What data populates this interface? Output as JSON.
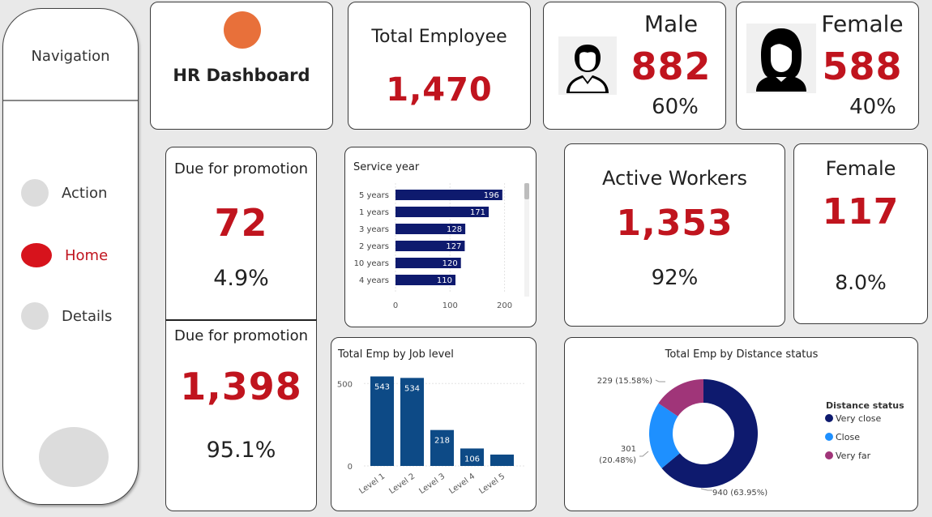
{
  "nav": {
    "title": "Navigation",
    "items": [
      {
        "label": "Action",
        "color": "#dcdcdc",
        "text_color": "#333333"
      },
      {
        "label": "Home",
        "color": "#d7131c",
        "text_color": "#c0141e"
      },
      {
        "label": "Details",
        "color": "#dcdcdc",
        "text_color": "#333333"
      }
    ]
  },
  "header": {
    "title": "HR Dashboard",
    "logo_color": "#e8703a"
  },
  "kpi": {
    "total_employee": {
      "label": "Total Employee",
      "value": "1,470"
    },
    "male": {
      "label": "Male",
      "value": "882",
      "pct": "60%"
    },
    "female": {
      "label": "Female",
      "value": "588",
      "pct": "40%"
    },
    "promo1": {
      "label": "Due for promotion",
      "value": "72",
      "pct": "4.9%"
    },
    "promo2": {
      "label": "Due for promotion",
      "value": "1,398",
      "pct": "95.1%"
    },
    "active": {
      "label": "Active Workers",
      "value": "1,353",
      "pct": "92%"
    },
    "female2": {
      "label": "Female",
      "value": "117",
      "pct": "8.0%"
    }
  },
  "colors": {
    "accent": "#c0141e",
    "bar_navy": "#0e1a6e",
    "bar_blue": "#0d4a86",
    "close": "#1e90ff",
    "very_far": "#a03579"
  },
  "chart_data": [
    {
      "type": "bar",
      "orientation": "horizontal",
      "title": "Service year",
      "categories": [
        "5 years",
        "1 years",
        "3 years",
        "2 years",
        "10 years",
        "4 years"
      ],
      "values": [
        196,
        171,
        128,
        127,
        120,
        110
      ],
      "xticks": [
        "0",
        "100",
        "200"
      ],
      "xlim": [
        0,
        220
      ]
    },
    {
      "type": "bar",
      "title": "Total Emp by Job level",
      "categories": [
        "Level 1",
        "Level 2",
        "Level 3",
        "Level 4",
        "Level 5"
      ],
      "values": [
        543,
        534,
        218,
        106,
        69
      ],
      "data_labels": [
        "543",
        "534",
        "218",
        "106",
        ""
      ],
      "yticks": [
        "0",
        "500"
      ],
      "ylim": [
        0,
        580
      ]
    },
    {
      "type": "pie",
      "title": "Total Emp by Distance status",
      "legend_title": "Distance status",
      "categories": [
        "Very close",
        "Close",
        "Very far"
      ],
      "values": [
        940,
        301,
        229
      ],
      "labels": [
        "940 (63.95%)",
        "301 (20.48%)",
        "229 (15.58%)"
      ],
      "label_close_line1": "301",
      "label_close_line2": "(20.48%)"
    }
  ]
}
